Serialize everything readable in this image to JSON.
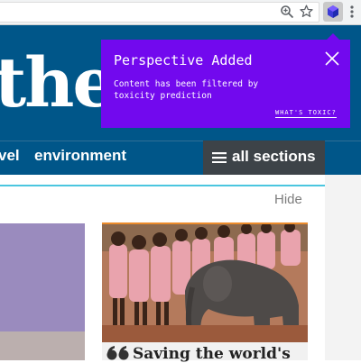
{
  "browser": {
    "icons": [
      "zoom-icon",
      "star-icon",
      "perspective-extension-icon",
      "kebab-menu-icon"
    ]
  },
  "site": {
    "logo_text": "theg",
    "nav": {
      "items": [
        "vel",
        "environment"
      ],
      "all_sections_label": "all sections"
    },
    "brand_color": "#005689"
  },
  "content": {
    "hide_label": "Hide",
    "feature_headline": "Saving the world's",
    "accent_color": "#4bc6df"
  },
  "popup": {
    "title": "Perspective Added",
    "message": "Content has been filtered by toxicity prediction",
    "link_label": "WHAT'S TOXIC?",
    "color": "#7209ee"
  }
}
